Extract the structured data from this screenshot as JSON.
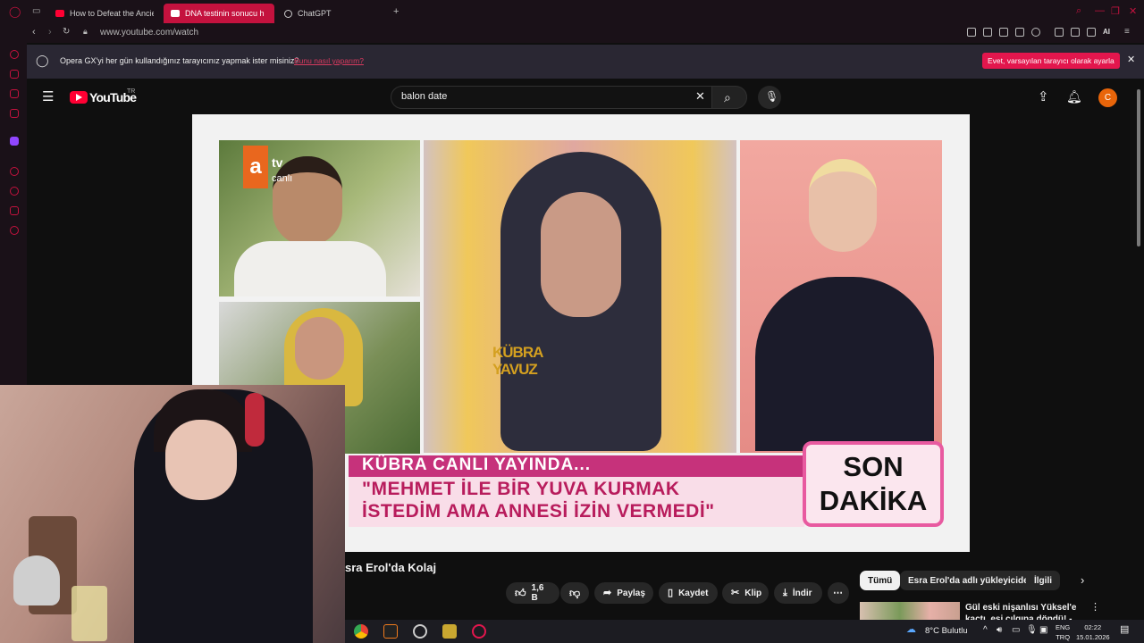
{
  "browser": {
    "tabs": [
      {
        "label": "How to Defeat the Ancient",
        "active": false
      },
      {
        "label": "DNA testinin sonucu h",
        "active": true
      },
      {
        "label": "ChatGPT",
        "active": false
      }
    ],
    "url": "www.youtube.com/watch",
    "accent": "#c4123e"
  },
  "banner": {
    "question": "Opera GX'yi her gün kullandığınız tarayıcınız yapmak ister misiniz?",
    "link": "Bunu nasıl yaparım?",
    "button": "Evet, varsayılan tarayıcı olarak ayarla"
  },
  "youtube": {
    "logo": "YouTube",
    "region": "TR",
    "search_value": "balon date",
    "avatar_letter": "C",
    "avatar_color": "#e8650a"
  },
  "video_frame": {
    "channel_logo": "a",
    "channel_tv": "tv",
    "channel_live": "canlı",
    "name_overlay": "KÜBRA YAVUZ",
    "headline": "KÜBRA CANLI YAYINDA...",
    "quote_line1": "\"MEHMET İLE BİR YUVA KURMAK",
    "quote_line2": "İSTEDİM AMA ANNESİ İZİN VERMEDİ\"",
    "badge_line1": "SON",
    "badge_line2": "DAKİKA"
  },
  "below": {
    "title": "sra Erol'da Kolaj",
    "like_count": "1,6 B",
    "share": "Paylaş",
    "save": "Kaydet",
    "clip": "Klip",
    "download": "İndir",
    "chips": [
      "Tümü",
      "Esra Erol'da adlı yükleyiciden",
      "İlgili"
    ],
    "rec_title": "Gül eski nişanlısı Yüksel'e kaçtı, eşi çılgına döndü! - Esra Erol'da"
  },
  "taskbar": {
    "weather": "8°C  Bulutlu",
    "lang1": "ENG",
    "lang2": "TRQ",
    "time": "02:22",
    "date": "15.01.2026"
  }
}
